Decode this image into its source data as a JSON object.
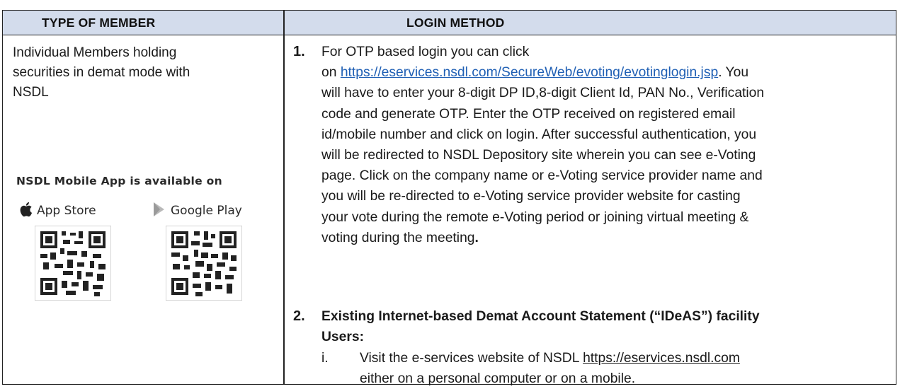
{
  "header": {
    "col1": "TYPE OF MEMBER",
    "col2": "LOGIN METHOD"
  },
  "left": {
    "member_type_lines": [
      "Individual Members holding",
      "securities in demat mode with",
      "NSDL"
    ],
    "app_title": "NSDL Mobile App is available on",
    "app_store_label": "App Store",
    "google_play_label": "Google Play",
    "apple_icon": "apple-logo-icon",
    "play_icon": "google-play-icon"
  },
  "steps": [
    {
      "number": "1.",
      "line1": "For OTP based login you can click",
      "line2_prefix": "on ",
      "link": "https://eservices.nsdl.com/SecureWeb/evoting/evotinglogin.jsp",
      "line2_suffix": ". You",
      "lines": [
        "will have to enter your 8-digit DP ID,8-digit Client Id, PAN No., Verification",
        "code and generate OTP. Enter the OTP received on registered email",
        "id/mobile number and click on login. After successful authentication, you",
        "will be redirected to NSDL Depository site wherein you can see e-Voting",
        "page. Click on the company name or e-Voting service provider name and",
        "you will be re-directed to e-Voting service provider website for casting",
        "your vote during the remote e-Voting period or joining virtual meeting &"
      ],
      "last_line": "voting during the meeting",
      "last_punct": "."
    },
    {
      "number": "2.",
      "title_line1": "Existing Internet-based Demat Account Statement (“IDeAS”) facility",
      "title_line2": "Users:",
      "sub": {
        "number": "i.",
        "prefix": "Visit the e-services website of NSDL ",
        "link": "https://eservices.nsdl.com",
        "line2": "either on a personal computer or on a mobile."
      }
    }
  ],
  "colors": {
    "header_bg": "#d3dcec",
    "link": "#1f5fb4",
    "border": "#222222"
  }
}
